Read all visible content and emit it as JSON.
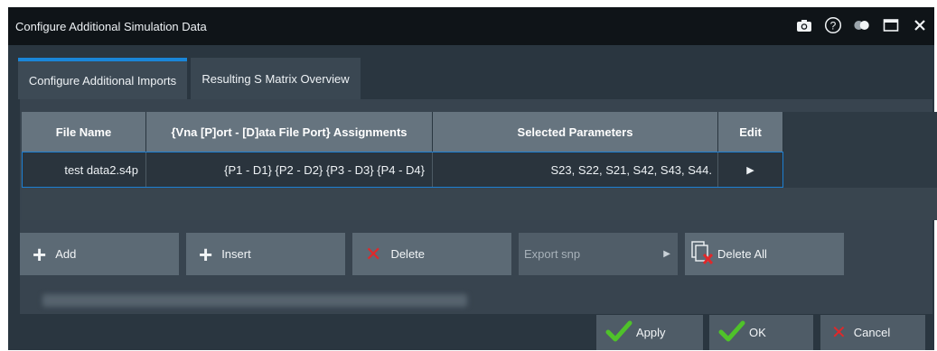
{
  "window": {
    "title": "Configure Additional Simulation Data",
    "icons": [
      "camera-icon",
      "help-icon",
      "toggle-icon",
      "maximize-icon",
      "close-icon"
    ]
  },
  "tabs": [
    {
      "label": "Configure Additional Imports",
      "active": true
    },
    {
      "label": "Resulting S Matrix Overview",
      "active": false
    }
  ],
  "table": {
    "columns": [
      "File Name",
      "{Vna [P]ort - [D]ata File Port} Assignments",
      "Selected Parameters",
      "Edit"
    ],
    "rows": [
      {
        "file_name": "test data2.s4p",
        "assignments": "{P1 - D1} {P2 - D2} {P3 - D3} {P4 - D4}",
        "parameters": "S23, S22, S21, S42, S43, S44.",
        "edit": "▶"
      }
    ]
  },
  "buttons": {
    "add": "Add",
    "insert": "Insert",
    "delete": "Delete",
    "export_snp": "Export snp",
    "delete_all": "Delete All"
  },
  "footer": {
    "apply": "Apply",
    "ok": "OK",
    "cancel": "Cancel"
  },
  "colors": {
    "accent": "#1a86d8",
    "check": "#4fc22a",
    "x_red": "#e0282a"
  }
}
